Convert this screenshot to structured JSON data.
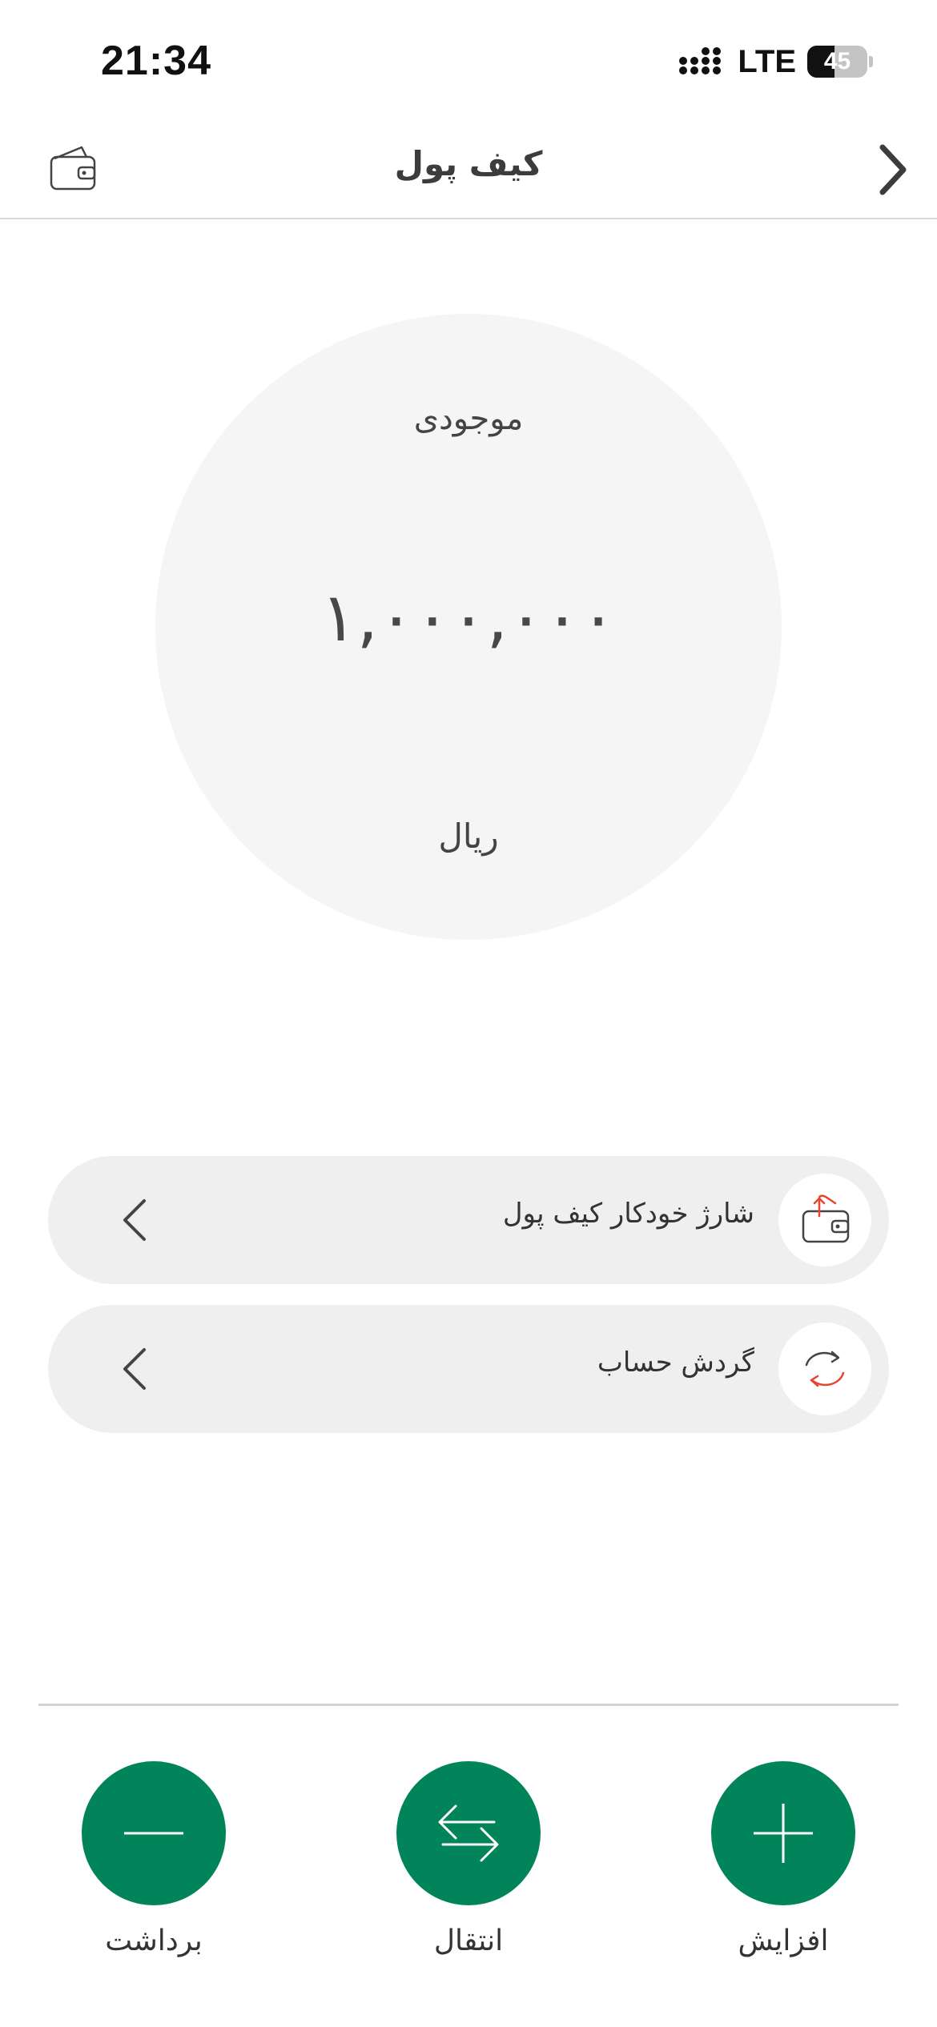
{
  "status_bar": {
    "time": "21:34",
    "network": "LTE",
    "battery": "45",
    "battery_level": 0.45
  },
  "header": {
    "title": "کیف پول",
    "wallet_icon": "wallet-icon",
    "back_icon": "chevron-right-icon"
  },
  "balance": {
    "label": "موجودی",
    "value": "۱,۰۰۰,۰۰۰",
    "unit": "ریال"
  },
  "menu": {
    "items": [
      {
        "label": "شارژ خودکار کیف پول",
        "icon": "wallet-auto-charge-icon",
        "chevron": "chevron-left-icon"
      },
      {
        "label": "گردش حساب",
        "icon": "refresh-cycle-icon",
        "chevron": "chevron-left-icon"
      }
    ]
  },
  "actions": {
    "withdraw_label": "برداشت",
    "transfer_label": "انتقال",
    "add_label": "افزایش"
  },
  "colors": {
    "primary": "#02845a",
    "accent_red": "#e8452c",
    "surface": "#efefef",
    "circle_bg": "#f5f5f5"
  }
}
